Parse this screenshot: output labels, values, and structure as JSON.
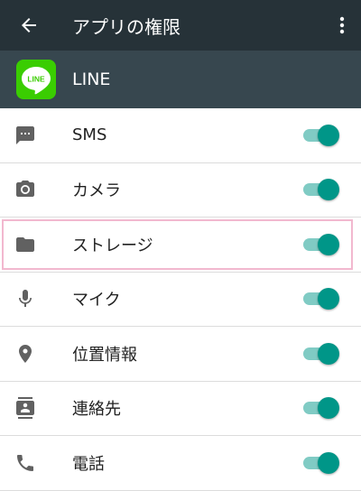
{
  "toolbar": {
    "title": "アプリの権限",
    "back_icon": "arrow-back-icon",
    "more_icon": "more-vert-icon",
    "background": "#263238"
  },
  "app": {
    "name": "LINE",
    "logo_text": "LINE",
    "brand_color": "#3acd01",
    "background": "#37474f"
  },
  "permissions": [
    {
      "label": "SMS",
      "icon": "sms-icon",
      "enabled": true
    },
    {
      "label": "カメラ",
      "icon": "camera-icon",
      "enabled": true
    },
    {
      "label": "ストレージ",
      "icon": "folder-icon",
      "enabled": true
    },
    {
      "label": "マイク",
      "icon": "mic-icon",
      "enabled": true
    },
    {
      "label": "位置情報",
      "icon": "location-icon",
      "enabled": true
    },
    {
      "label": "連絡先",
      "icon": "contacts-icon",
      "enabled": true
    },
    {
      "label": "電話",
      "icon": "phone-icon",
      "enabled": true
    }
  ],
  "colors": {
    "toggle_on": "#009688",
    "toggle_track": "#80cbc4",
    "icon": "#616161",
    "highlight": "#f2b8cf"
  }
}
